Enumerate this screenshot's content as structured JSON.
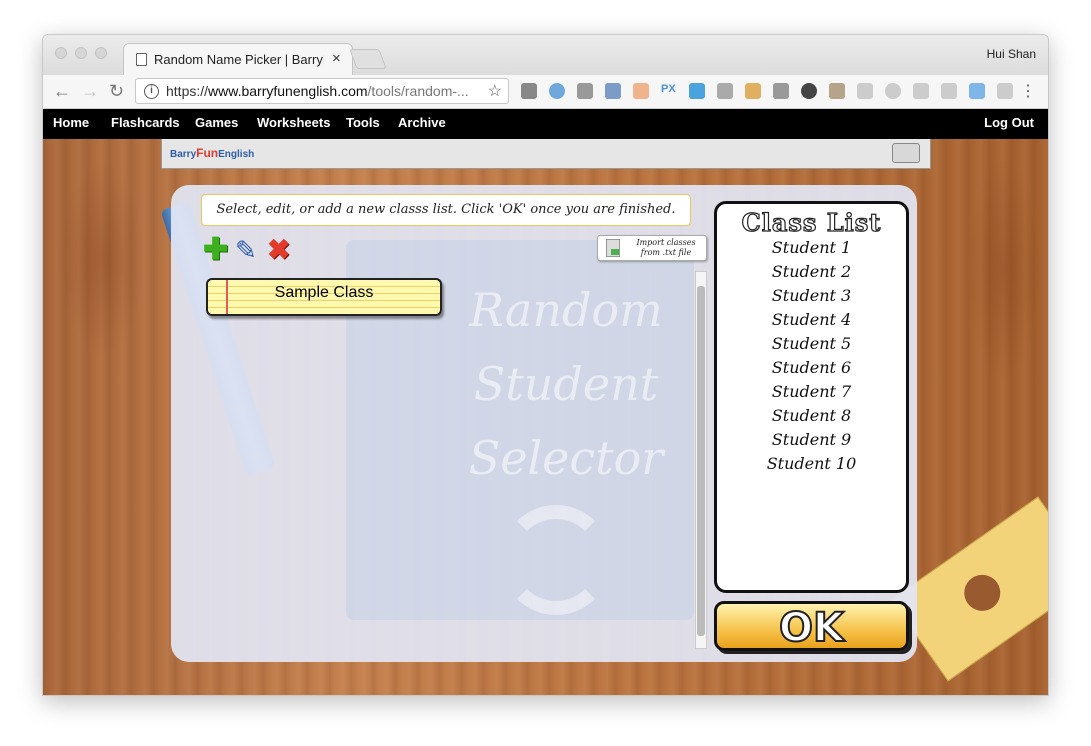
{
  "browser": {
    "tab_title": "Random Name Picker | BarryFu",
    "profile_name": "Hui Shan",
    "url_scheme": "https://",
    "url_host": "www.barryfunenglish.com",
    "url_path": "/tools/random-..."
  },
  "site_nav": {
    "items": [
      "Home",
      "Flashcards",
      "Games",
      "Worksheets",
      "Tools",
      "Archive"
    ],
    "logout": "Log Out"
  },
  "logo": {
    "part1": "Barry",
    "part2": "Fun",
    "part3": "English"
  },
  "tool": {
    "watermark_lines": [
      "Random",
      "Student",
      "Selector"
    ],
    "instruction": "Select, edit, or add a new classs list. Click 'OK' once you are finished.",
    "import_label_line1": "Import classes",
    "import_label_line2": "from .txt file",
    "classes": [
      "Sample Class"
    ],
    "class_list_title": "Class List",
    "students": [
      "Student 1",
      "Student 2",
      "Student 3",
      "Student 4",
      "Student 5",
      "Student 6",
      "Student 7",
      "Student 8",
      "Student 9",
      "Student 10"
    ],
    "ok_label": "OK"
  },
  "colors": {
    "site_nav_bg": "#000000",
    "add_icon": "#3cb01f",
    "delete_icon": "#e23b2c",
    "ok_button": "#f6c24a"
  }
}
